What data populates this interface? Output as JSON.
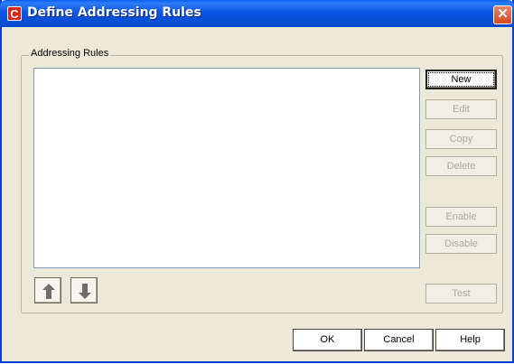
{
  "window": {
    "title": "Define Addressing Rules",
    "app_icon_glyph": "C",
    "close_glyph": "✕"
  },
  "group": {
    "label": "Addressing Rules",
    "rules": []
  },
  "side_buttons": {
    "new": "New",
    "edit": "Edit",
    "copy": "Copy",
    "delete": "Delete",
    "enable": "Enable",
    "disable": "Disable",
    "test": "Test"
  },
  "icons": {
    "move_up": "arrow-up-icon",
    "move_down": "arrow-down-icon"
  },
  "bottom_buttons": {
    "ok": "OK",
    "cancel": "Cancel",
    "help": "Help"
  },
  "colors": {
    "titlebar": "#0b56e4",
    "dialog_bg": "#ece9d8",
    "close": "#d54a22",
    "disabled_text": "#aca899"
  }
}
